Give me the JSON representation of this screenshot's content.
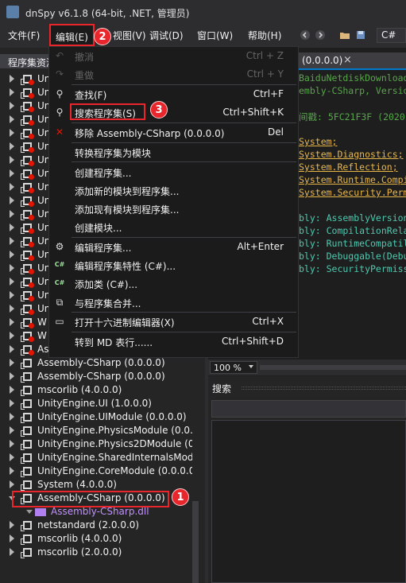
{
  "window": {
    "title": "dnSpy v6.1.8 (64-bit, .NET, 管理员)"
  },
  "menubar": {
    "file": "文件(F)",
    "edit": "编辑(E)",
    "view": "视图(V)",
    "debug": "调试(D)",
    "window": "窗口(W)",
    "help": "帮助(H)",
    "language": "C#"
  },
  "left_panel": {
    "title": "程序集资源管理器",
    "tree": [
      {
        "text": "Un",
        "expanded": false,
        "error": true
      },
      {
        "text": "Un",
        "expanded": false,
        "error": true
      },
      {
        "text": "Un",
        "expanded": false,
        "error": true
      },
      {
        "text": "Un",
        "expanded": false,
        "error": true
      },
      {
        "text": "Un",
        "expanded": false,
        "error": true
      },
      {
        "text": "Un",
        "expanded": false,
        "error": true
      },
      {
        "text": "Un",
        "expanded": false,
        "error": true
      },
      {
        "text": "Un",
        "expanded": false,
        "error": true
      },
      {
        "text": "Un",
        "expanded": false,
        "error": true
      },
      {
        "text": "Un",
        "expanded": false,
        "error": true
      },
      {
        "text": "Un",
        "expanded": false,
        "error": true
      },
      {
        "text": "Un",
        "expanded": false,
        "error": true
      },
      {
        "text": "Un",
        "expanded": false,
        "error": true
      },
      {
        "text": "Un",
        "expanded": false,
        "error": true
      },
      {
        "text": "Un",
        "expanded": false,
        "error": true
      },
      {
        "text": "Un",
        "expanded": false,
        "error": true
      },
      {
        "text": "Un",
        "expanded": false,
        "error": true
      },
      {
        "text": "Un",
        "expanded": false,
        "error": true
      },
      {
        "text": "W",
        "expanded": false,
        "error": true
      },
      {
        "text": "W",
        "expanded": false,
        "error": true
      },
      {
        "text": "As",
        "expanded": false,
        "error": true
      },
      {
        "text": "Assembly-CSharp (0.0.0.0)",
        "expanded": false,
        "error": false
      },
      {
        "text": "Assembly-CSharp (0.0.0.0)",
        "expanded": false,
        "error": false
      },
      {
        "text": "mscorlib (4.0.0.0)",
        "expanded": false,
        "error": false
      },
      {
        "text": "UnityEngine.UI (1.0.0.0)",
        "expanded": false,
        "error": false
      },
      {
        "text": "UnityEngine.UIModule (0.0.0.0)",
        "expanded": false,
        "error": false
      },
      {
        "text": "UnityEngine.PhysicsModule (0.0.0.0",
        "expanded": false,
        "error": false
      },
      {
        "text": "UnityEngine.Physics2DModule (0.0",
        "expanded": false,
        "error": false
      },
      {
        "text": "UnityEngine.SharedInternalsModu",
        "expanded": false,
        "error": false
      },
      {
        "text": "UnityEngine.CoreModule (0.0.0.0)",
        "expanded": false,
        "error": false
      },
      {
        "text": "System (4.0.0.0)",
        "expanded": false,
        "error": false
      },
      {
        "text": "Assembly-CSharp (0.0.0.0)",
        "expanded": true,
        "error": false
      },
      {
        "text": "Assembly-CSharp.dll",
        "expanded": false,
        "error": false,
        "child": true
      },
      {
        "text": "netstandard (2.0.0.0)",
        "expanded": false,
        "error": false
      },
      {
        "text": "mscorlib (4.0.0.0)",
        "expanded": false,
        "error": false
      },
      {
        "text": "mscorlib (2.0.0.0)",
        "expanded": false,
        "error": false
      }
    ]
  },
  "editor": {
    "tab_label": "(0.0.0.0)",
    "tab_close": "×",
    "lines": [
      {
        "text": "BaiduNetdiskDownload",
        "kind": "cmt"
      },
      {
        "text": "embly-CSharp, Versio",
        "kind": "cmt"
      },
      {
        "text": "",
        "kind": "cmt"
      },
      {
        "text": "间戳: 5FC21F3F (2020-",
        "kind": "cmt"
      },
      {
        "text": "",
        "kind": "cmt"
      },
      {
        "text": "System;",
        "kind": "ns"
      },
      {
        "text": "System.Diagnostics;",
        "kind": "ns"
      },
      {
        "text": "System.Reflection;",
        "kind": "ns"
      },
      {
        "text": "System.Runtime.Compi",
        "kind": "ns"
      },
      {
        "text": "System.Security.Perm",
        "kind": "ns"
      },
      {
        "text": "",
        "kind": "cmt"
      },
      {
        "text": "bly: AssemblyVersion",
        "kind": "attr"
      },
      {
        "text": "bly: CompilationRela",
        "kind": "attr"
      },
      {
        "text": "bly: RuntimeCompatil",
        "kind": "attr"
      },
      {
        "text": "bly: Debuggable(Debu",
        "kind": "attr"
      },
      {
        "text": "bly: SecurityPermiss",
        "kind": "attr"
      }
    ],
    "zoom": "100 %"
  },
  "search_panel": {
    "title": "搜索"
  },
  "edit_menu": {
    "items": [
      {
        "type": "item",
        "label": "撤消",
        "shortcut": "Ctrl + Z",
        "disabled": true,
        "icon": "undo-icon",
        "glyph": "↶"
      },
      {
        "type": "item",
        "label": "重做",
        "shortcut": "Ctrl + Y",
        "disabled": true,
        "icon": "redo-icon",
        "glyph": "↷"
      },
      {
        "type": "sep"
      },
      {
        "type": "item",
        "label": "查找(F)",
        "shortcut": "Ctrl+F",
        "disabled": false,
        "icon": "search-icon",
        "glyph": "⚲"
      },
      {
        "type": "item",
        "label": "搜索程序集(S)",
        "shortcut": "Ctrl+Shift+K",
        "disabled": false,
        "icon": "search-icon",
        "glyph": "⚲"
      },
      {
        "type": "sep"
      },
      {
        "type": "item",
        "label": "移除 Assembly-CSharp (0.0.0.0)",
        "shortcut": "Del",
        "disabled": false,
        "icon": "remove-icon",
        "glyph": "✕"
      },
      {
        "type": "sep"
      },
      {
        "type": "item",
        "label": "转换程序集为模块",
        "shortcut": "",
        "disabled": false,
        "icon": "",
        "glyph": ""
      },
      {
        "type": "sep"
      },
      {
        "type": "item",
        "label": "创建程序集...",
        "shortcut": "",
        "disabled": false,
        "icon": "",
        "glyph": ""
      },
      {
        "type": "item",
        "label": "添加新的模块到程序集...",
        "shortcut": "",
        "disabled": false,
        "icon": "",
        "glyph": ""
      },
      {
        "type": "item",
        "label": "添加现有模块到程序集...",
        "shortcut": "",
        "disabled": false,
        "icon": "",
        "glyph": ""
      },
      {
        "type": "item",
        "label": "创建模块...",
        "shortcut": "",
        "disabled": false,
        "icon": "",
        "glyph": ""
      },
      {
        "type": "sep"
      },
      {
        "type": "item",
        "label": "编辑程序集...",
        "shortcut": "Alt+Enter",
        "disabled": false,
        "icon": "gear-icon",
        "glyph": "⚙"
      },
      {
        "type": "item",
        "label": "编辑程序集特性 (C#)...",
        "shortcut": "",
        "disabled": false,
        "icon": "csharp-icon",
        "glyph": "C#"
      },
      {
        "type": "item",
        "label": "添加类 (C#)...",
        "shortcut": "",
        "disabled": false,
        "icon": "csharp-icon",
        "glyph": "C#"
      },
      {
        "type": "item",
        "label": "与程序集合并...",
        "shortcut": "",
        "disabled": false,
        "icon": "merge-icon",
        "glyph": "⧉"
      },
      {
        "type": "sep"
      },
      {
        "type": "item",
        "label": "打开十六进制编辑器(X)",
        "shortcut": "Ctrl+X",
        "disabled": false,
        "icon": "hex-editor-icon",
        "glyph": "▭"
      },
      {
        "type": "sep"
      },
      {
        "type": "item",
        "label": "转到 MD 表行......",
        "shortcut": "Ctrl+Shift+D",
        "disabled": false,
        "icon": "",
        "glyph": ""
      }
    ]
  },
  "badges": {
    "one": "1",
    "two": "2",
    "three": "3"
  },
  "colors": {
    "accent": "#007acc",
    "highlight": "#e8262b",
    "error": "#e51400"
  }
}
